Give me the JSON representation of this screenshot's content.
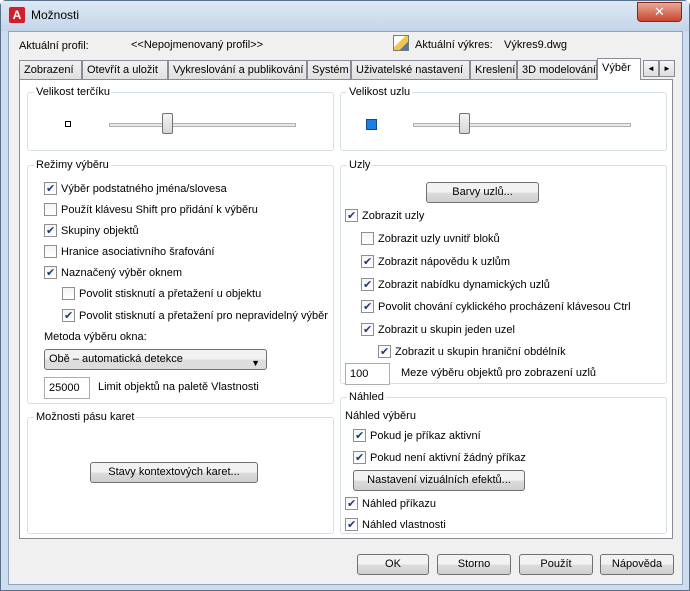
{
  "window": {
    "title": "Možnosti",
    "close": "✕"
  },
  "header": {
    "profile_label": "Aktuální profil:",
    "profile_value": "<<Nepojmenovaný profil>>",
    "drawing_label": "Aktuální výkres:",
    "drawing_value": "Výkres9.dwg"
  },
  "tabs": [
    "Zobrazení",
    "Otevřít a uložit",
    "Vykreslování a publikování",
    "Systém",
    "Uživatelské nastavení",
    "Kreslení",
    "3D modelování",
    "Výběr"
  ],
  "tab_arrows": [
    "◄",
    "►"
  ],
  "pickbox": {
    "legend": "Velikost terčíku",
    "level": 0.3
  },
  "gripsize": {
    "legend": "Velikost uzlu",
    "level": 0.22,
    "color": "#1f7ee0"
  },
  "modes": {
    "legend": "Režimy výběru",
    "items": [
      {
        "label": "Výběr podstatného jména/slovesa",
        "checked": true
      },
      {
        "label": "Použít klávesu Shift pro přidání k výběru",
        "checked": false
      },
      {
        "label": "Skupiny objektů",
        "checked": true
      },
      {
        "label": "Hranice asociativního šrafování",
        "checked": false
      },
      {
        "label": "Naznačený výběr oknem",
        "checked": true
      },
      {
        "label": "Povolit stisknutí a přetažení u objektu",
        "checked": false
      },
      {
        "label": "Povolit stisknutí a přetažení pro nepravidelný výběr",
        "checked": true
      }
    ],
    "window_method_label": "Metoda výběru okna:",
    "window_method_value": "Obě – automatická detekce",
    "limit_value": "25000",
    "limit_label": "Limit objektů na paletě Vlastnosti"
  },
  "ribbon": {
    "legend": "Možnosti pásu karet",
    "button": "Stavy kontextových karet..."
  },
  "grips": {
    "legend": "Uzly",
    "color_button": "Barvy uzlů...",
    "items": [
      {
        "label": "Zobrazit uzly",
        "checked": true
      },
      {
        "label": "Zobrazit uzly uvnitř bloků",
        "checked": false
      },
      {
        "label": "Zobrazit nápovědu k uzlům",
        "checked": true
      },
      {
        "label": "Zobrazit nabídku dynamických uzlů",
        "checked": true
      },
      {
        "label": "Povolit chování cyklického procházení klávesou Ctrl",
        "checked": true
      },
      {
        "label": "Zobrazit u skupin jeden uzel",
        "checked": true
      },
      {
        "label": "Zobrazit u skupin hraniční obdélník",
        "checked": true
      }
    ],
    "limit_value": "100",
    "limit_label": "Meze výběru objektů pro zobrazení uzlů"
  },
  "preview": {
    "legend": "Náhled",
    "sub_label": "Náhled výběru",
    "items": [
      {
        "label": "Pokud je příkaz aktivní",
        "checked": true
      },
      {
        "label": "Pokud není aktivní žádný příkaz",
        "checked": true
      }
    ],
    "effects_button": "Nastavení vizuálních efektů...",
    "items2": [
      {
        "label": "Náhled příkazu",
        "checked": true
      },
      {
        "label": "Náhled vlastnosti",
        "checked": true
      }
    ]
  },
  "footer": {
    "ok": "OK",
    "cancel": "Storno",
    "apply": "Použít",
    "help": "Nápověda"
  }
}
